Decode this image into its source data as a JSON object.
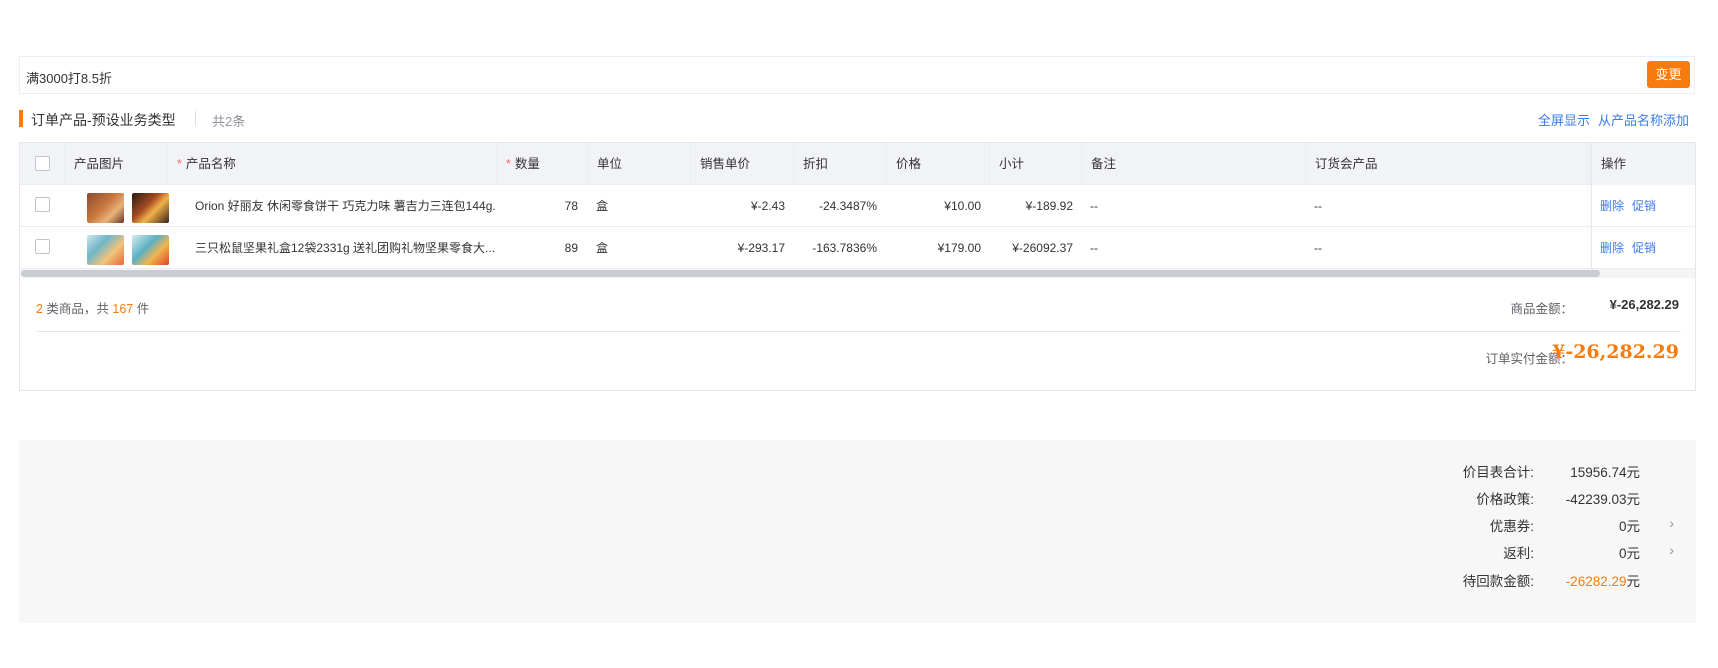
{
  "promo": {
    "text": "满3000打8.5折",
    "button": "变更"
  },
  "section": {
    "title": "订单产品-预设业务类型",
    "count": "共2条",
    "links": [
      "全屏显示",
      "从产品名称添加"
    ]
  },
  "table": {
    "columns": {
      "image": "产品图片",
      "name": "产品名称",
      "qty": "数量",
      "unit": "单位",
      "sale_price": "销售单价",
      "discount": "折扣",
      "price": "价格",
      "subtotal": "小计",
      "note": "备注",
      "order_product": "订货会产品",
      "ops": "操作"
    },
    "rows": [
      {
        "name": "Orion 好丽友 休闲零食饼干 巧克力味 薯吉力三连包144g...",
        "qty": "78",
        "unit": "盒",
        "sale_price": "¥-2.43",
        "discount": "-24.3487%",
        "price": "¥10.00",
        "subtotal": "¥-189.92",
        "note": "--",
        "order_product": "--",
        "ops": [
          "删除",
          "促销"
        ]
      },
      {
        "name": "三只松鼠坚果礼盒12袋2331g 送礼团购礼物坚果零食大...",
        "qty": "89",
        "unit": "盒",
        "sale_price": "¥-293.17",
        "discount": "-163.7836%",
        "price": "¥179.00",
        "subtotal": "¥-26092.37",
        "note": "--",
        "order_product": "--",
        "ops": [
          "删除",
          "促销"
        ]
      }
    ]
  },
  "summary": {
    "kinds": "2",
    "kinds_text": " 类商品，共 ",
    "pieces": "167",
    "pieces_text": " 件",
    "goods_amount_label": "商品金额：",
    "goods_amount": "¥-26,282.29",
    "pay_label": "订单实付金额：",
    "pay_amount": "¥-26,282.29"
  },
  "totals": {
    "list_total_label": "价目表合计:",
    "list_total": "15956.74元",
    "policy_label": "价格政策:",
    "policy": "-42239.03元",
    "coupon_label": "优惠券:",
    "coupon": "0元",
    "rebate_label": "返利:",
    "rebate": "0元",
    "pending_label": "待回款金额:",
    "pending_amount": "-26282.29",
    "pending_unit": "元"
  },
  "colors": {
    "accent": "#f77b0f",
    "link": "#3b7ce8"
  }
}
